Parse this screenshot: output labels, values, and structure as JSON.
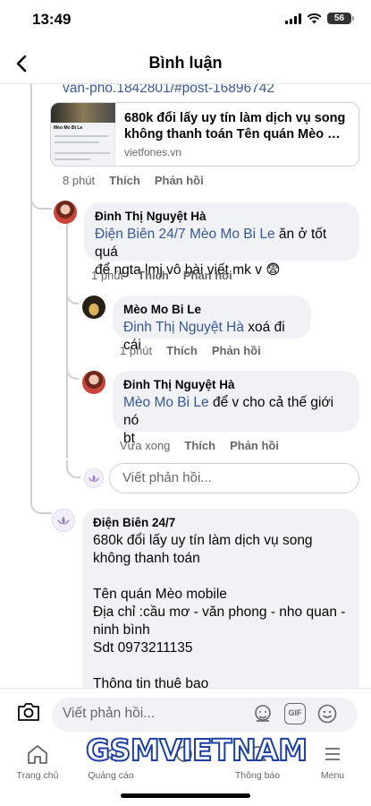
{
  "status": {
    "time": "13:49",
    "battery": "56"
  },
  "header": {
    "title": "Bình luận"
  },
  "link": {
    "url_text": "van-pho.1842801/#post-16896742",
    "preview_title_line1": "680k đổi lấy uy tín làm dịch vụ song",
    "preview_title_line2": "không thanh toán Tên quán Mèo mo...",
    "preview_domain": "vietfones.vn",
    "thumb_name": "Mèo Mo Bi Le"
  },
  "comment_top_meta": {
    "time": "8 phút",
    "like": "Thích",
    "reply": "Phản hồi"
  },
  "replies": [
    {
      "author": "Đinh Thị Nguyệt Hà",
      "tag": "Điện Biên 24/7  Mèo Mo Bi Le",
      "text_line1": " ăn ở tốt quá",
      "text_line2": "để ngta lmj vô bài viết mk v 😨",
      "time": "1 phút",
      "like": "Thích",
      "reply": "Phản hồi"
    },
    {
      "author": "Mèo Mo Bi Le",
      "tag": "Đinh Thị Nguyệt Hà",
      "text": " xoá đi cái",
      "time": "1 phút",
      "like": "Thích",
      "reply": "Phản hồi"
    },
    {
      "author": "Đinh Thị Nguyệt Hà",
      "tag": "Mèo Mo Bi Le",
      "text_line1": "  để v cho cả thế giới nó",
      "text_line2": "bt",
      "time": "Vừa xong",
      "like": "Thích",
      "reply": "Phản hồi"
    }
  ],
  "reply_input": {
    "placeholder": "Viết phản hồi..."
  },
  "main_comment": {
    "author": "Điện Biên 24/7",
    "lines": [
      "680k đổi lấy uy tín làm dịch vụ song",
      "không thanh toán",
      "",
      "Tên quán Mèo mobile",
      "Địa chỉ :cầu mơ - văn phong - nho quan -",
      "ninh bình",
      "Sdt 0973211135",
      "",
      "Thông tin thuê bao"
    ]
  },
  "composer": {
    "placeholder": "Viết phản hồi...",
    "gif": "GIF"
  },
  "tabs": [
    {
      "label": "Trang chủ",
      "icon": "home-icon"
    },
    {
      "label": "Quảng cáo",
      "icon": "megaphone-icon"
    },
    {
      "label": "",
      "icon": "notifications-icon"
    },
    {
      "label": "Thông báo",
      "icon": "bell-icon"
    },
    {
      "label": "Menu",
      "icon": "menu-icon"
    }
  ],
  "watermark": "GSMVIETNAM",
  "colors": {
    "link": "#385898",
    "bubble": "#f0f2f5",
    "muted": "#65676b"
  }
}
